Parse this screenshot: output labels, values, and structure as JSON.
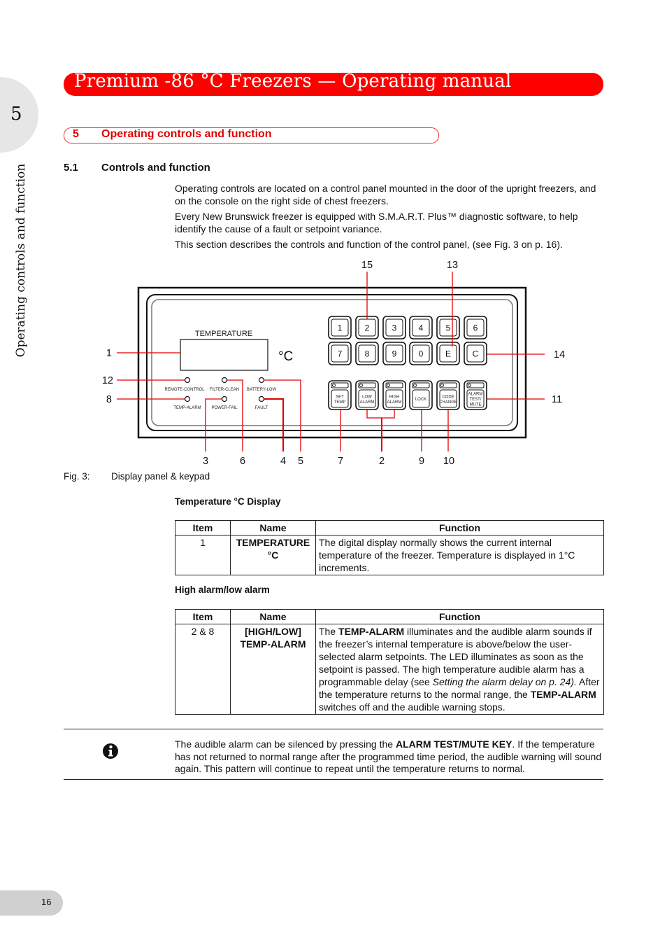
{
  "header": {
    "title": "Premium -86 °C Freezers  —  Operating manual",
    "chapter_number": "5",
    "side_label": "Operating controls and function",
    "accent_color": "#ff0000"
  },
  "section": {
    "number": "5",
    "title": "Operating controls and function"
  },
  "subsection": {
    "number": "5.1",
    "title": "Controls and function"
  },
  "intro_paragraphs": [
    "Operating controls are located on a control panel mounted in the door of the upright freezers, and on the console on the right side of chest freezers.",
    "Every New Brunswick freezer is equipped with S.M.A.R.T. Plus™ diagnostic software, to help identify the cause of a fault or setpoint variance.",
    "This section describes the controls and function of the control panel, (see Fig. 3 on p. 16)."
  ],
  "figure": {
    "display_label": "TEMPERATURE",
    "degree_unit": "°C",
    "leds": [
      "REMOTE-CONTROL",
      "FILTER-CLEAN",
      "BATTERY-LOW",
      "TEMP-ALARM",
      "POWER-FAIL",
      "FAULT"
    ],
    "keypad_row1": [
      "1",
      "2",
      "3",
      "4",
      "5",
      "6"
    ],
    "keypad_row2": [
      "7",
      "8",
      "9",
      "0",
      "E",
      "C"
    ],
    "function_keys": [
      [
        "SET",
        "TEMP"
      ],
      [
        "LOW",
        "ALARM"
      ],
      [
        "HIGH",
        "ALARM"
      ],
      [
        "LOCK"
      ],
      [
        "CODE",
        "CHANGE"
      ],
      [
        "ALARM",
        "TEST/",
        "MUTE"
      ]
    ],
    "callouts": {
      "top": [
        "15",
        "13"
      ],
      "left": [
        "1",
        "12",
        "8"
      ],
      "right": [
        "14",
        "11"
      ],
      "bottom": [
        "3",
        "6",
        "4",
        "5",
        "7",
        "2",
        "9",
        "10"
      ]
    },
    "caption_label": "Fig. 3:",
    "caption_text": "Display panel & keypad"
  },
  "tables": [
    {
      "heading": "Temperature °C Display",
      "columns": [
        "Item",
        "Name",
        "Function"
      ],
      "rows": [
        {
          "item": "1",
          "name_line1": "TEMPERATURE",
          "name_line2": "°C",
          "function": "The digital display normally shows the current internal temperature of the freezer. Temperature is displayed in 1°C increments."
        }
      ]
    },
    {
      "heading": "High alarm/low alarm",
      "columns": [
        "Item",
        "Name",
        "Function"
      ],
      "rows": [
        {
          "item": "2 & 8",
          "name_line1": "[HIGH/LOW]",
          "name_line2": "TEMP-ALARM",
          "function_parts": {
            "p1": "The ",
            "b1": "TEMP-ALARM",
            "p2": " illuminates and the audible alarm sounds if the freezer’s internal temperature is above/below the user-selected alarm setpoints. The LED illuminates as soon as the setpoint is passed. The high temperature audible alarm has a programmable delay (see ",
            "i1": "Setting the alarm delay on p. 24).",
            "p3": " After the temperature returns to the normal range, the ",
            "b2": "TEMP-ALARM",
            "p4": " switches off and the audible warning stops."
          }
        }
      ]
    }
  ],
  "note": {
    "icon": "info-icon",
    "p1": "The audible alarm can be silenced by pressing the ",
    "b1": "ALARM TEST/MUTE KEY",
    "p2": ". If the temperature has not returned to normal range after the programmed time period, the audible warning will sound again. This pattern will continue to repeat until the temperature returns to normal."
  },
  "footer": {
    "page_number": "16"
  }
}
